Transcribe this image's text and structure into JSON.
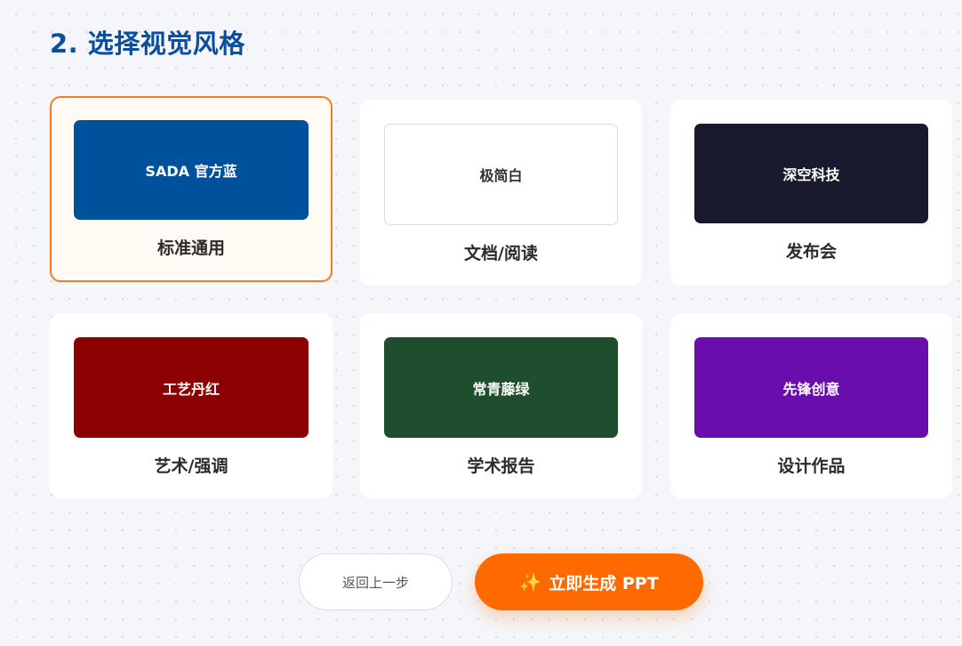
{
  "section": {
    "title": "2. 选择视觉风格"
  },
  "styles": [
    {
      "swatch_text": "SADA 官方蓝",
      "label": "标准通用",
      "color": "#00519c",
      "text_color": "#ffffff",
      "selected": true
    },
    {
      "swatch_text": "极简白",
      "label": "文档/阅读",
      "color": "#ffffff",
      "text_color": "#333333",
      "selected": false
    },
    {
      "swatch_text": "深空科技",
      "label": "发布会",
      "color": "#1a1a2e",
      "text_color": "#ffffff",
      "selected": false
    },
    {
      "swatch_text": "工艺丹红",
      "label": "艺术/强调",
      "color": "#8b0000",
      "text_color": "#ffffff",
      "selected": false
    },
    {
      "swatch_text": "常青藤绿",
      "label": "学术报告",
      "color": "#1e4e2e",
      "text_color": "#ffffff",
      "selected": false
    },
    {
      "swatch_text": "先锋创意",
      "label": "设计作品",
      "color": "#6a0dad",
      "text_color": "#ffffff",
      "selected": false
    }
  ],
  "actions": {
    "back_label": "返回上一步",
    "generate_icon": "sparkles-icon",
    "generate_icon_glyph": "✨",
    "generate_label": "立即生成 PPT"
  },
  "colors": {
    "title": "#0b4e9b",
    "selected_border": "#f57c1f",
    "primary_button": "#ff6a00"
  }
}
